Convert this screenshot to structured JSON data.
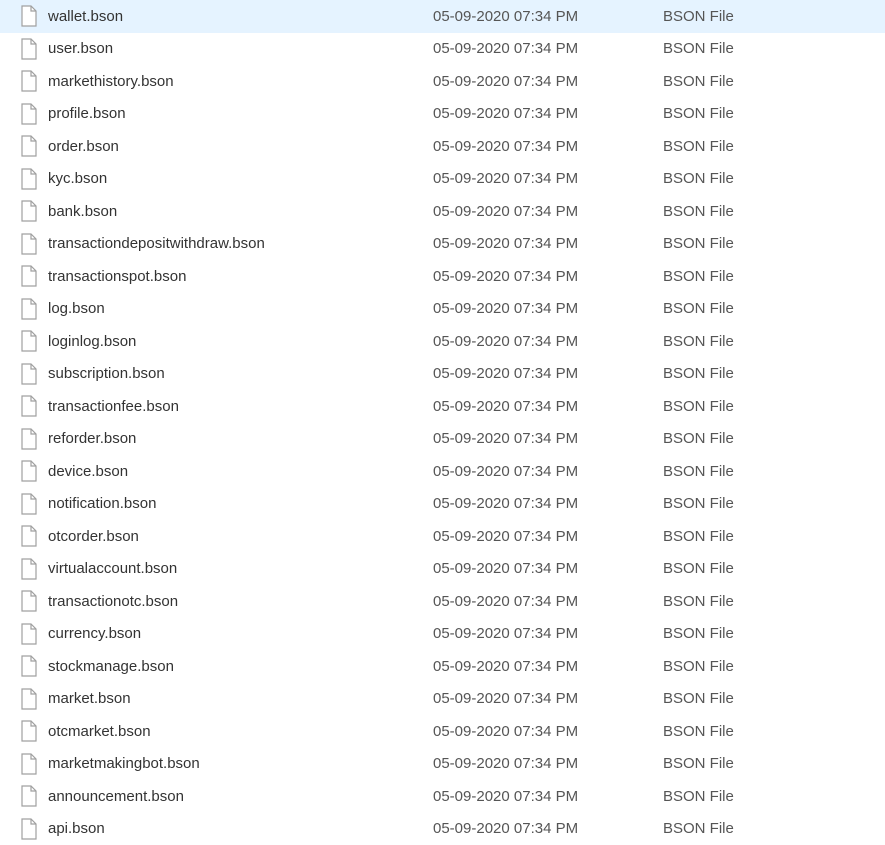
{
  "files": [
    {
      "name": "wallet.bson",
      "date": "05-09-2020 07:34 PM",
      "type": "BSON File"
    },
    {
      "name": "user.bson",
      "date": "05-09-2020 07:34 PM",
      "type": "BSON File"
    },
    {
      "name": "markethistory.bson",
      "date": "05-09-2020 07:34 PM",
      "type": "BSON File"
    },
    {
      "name": "profile.bson",
      "date": "05-09-2020 07:34 PM",
      "type": "BSON File"
    },
    {
      "name": "order.bson",
      "date": "05-09-2020 07:34 PM",
      "type": "BSON File"
    },
    {
      "name": "kyc.bson",
      "date": "05-09-2020 07:34 PM",
      "type": "BSON File"
    },
    {
      "name": "bank.bson",
      "date": "05-09-2020 07:34 PM",
      "type": "BSON File"
    },
    {
      "name": "transactiondepositwithdraw.bson",
      "date": "05-09-2020 07:34 PM",
      "type": "BSON File"
    },
    {
      "name": "transactionspot.bson",
      "date": "05-09-2020 07:34 PM",
      "type": "BSON File"
    },
    {
      "name": "log.bson",
      "date": "05-09-2020 07:34 PM",
      "type": "BSON File"
    },
    {
      "name": "loginlog.bson",
      "date": "05-09-2020 07:34 PM",
      "type": "BSON File"
    },
    {
      "name": "subscription.bson",
      "date": "05-09-2020 07:34 PM",
      "type": "BSON File"
    },
    {
      "name": "transactionfee.bson",
      "date": "05-09-2020 07:34 PM",
      "type": "BSON File"
    },
    {
      "name": "reforder.bson",
      "date": "05-09-2020 07:34 PM",
      "type": "BSON File"
    },
    {
      "name": "device.bson",
      "date": "05-09-2020 07:34 PM",
      "type": "BSON File"
    },
    {
      "name": "notification.bson",
      "date": "05-09-2020 07:34 PM",
      "type": "BSON File"
    },
    {
      "name": "otcorder.bson",
      "date": "05-09-2020 07:34 PM",
      "type": "BSON File"
    },
    {
      "name": "virtualaccount.bson",
      "date": "05-09-2020 07:34 PM",
      "type": "BSON File"
    },
    {
      "name": "transactionotc.bson",
      "date": "05-09-2020 07:34 PM",
      "type": "BSON File"
    },
    {
      "name": "currency.bson",
      "date": "05-09-2020 07:34 PM",
      "type": "BSON File"
    },
    {
      "name": "stockmanage.bson",
      "date": "05-09-2020 07:34 PM",
      "type": "BSON File"
    },
    {
      "name": "market.bson",
      "date": "05-09-2020 07:34 PM",
      "type": "BSON File"
    },
    {
      "name": "otcmarket.bson",
      "date": "05-09-2020 07:34 PM",
      "type": "BSON File"
    },
    {
      "name": "marketmakingbot.bson",
      "date": "05-09-2020 07:34 PM",
      "type": "BSON File"
    },
    {
      "name": "announcement.bson",
      "date": "05-09-2020 07:34 PM",
      "type": "BSON File"
    },
    {
      "name": "api.bson",
      "date": "05-09-2020 07:34 PM",
      "type": "BSON File"
    }
  ]
}
